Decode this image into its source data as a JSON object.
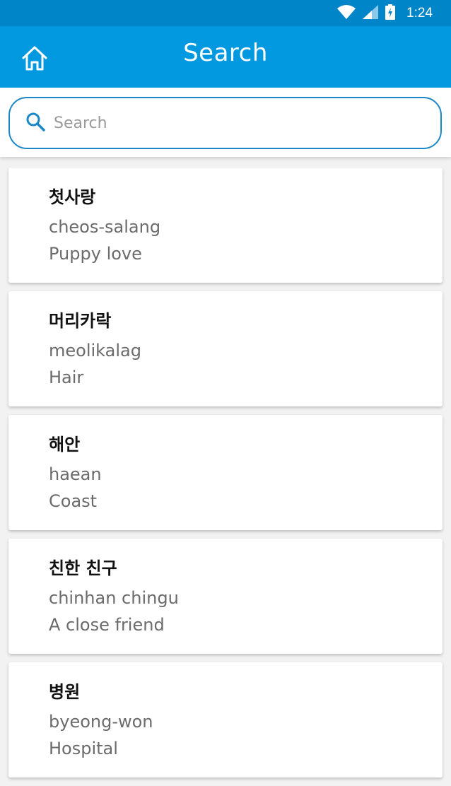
{
  "status_bar": {
    "time": "1:24"
  },
  "app_bar": {
    "title": "Search"
  },
  "search": {
    "placeholder": "Search",
    "value": ""
  },
  "colors": {
    "primary": "#0299e0",
    "status_bar": "#0185c9",
    "accent_border": "#1b87c8"
  },
  "words": [
    {
      "korean": "첫사랑",
      "romanization": "cheos-salang",
      "english": "Puppy love"
    },
    {
      "korean": "머리카락",
      "romanization": "meolikalag",
      "english": "Hair"
    },
    {
      "korean": "해안",
      "romanization": "haean",
      "english": "Coast"
    },
    {
      "korean": "친한 친구",
      "romanization": "chinhan chingu",
      "english": "A close friend"
    },
    {
      "korean": "병원",
      "romanization": "byeong-won",
      "english": "Hospital"
    }
  ]
}
